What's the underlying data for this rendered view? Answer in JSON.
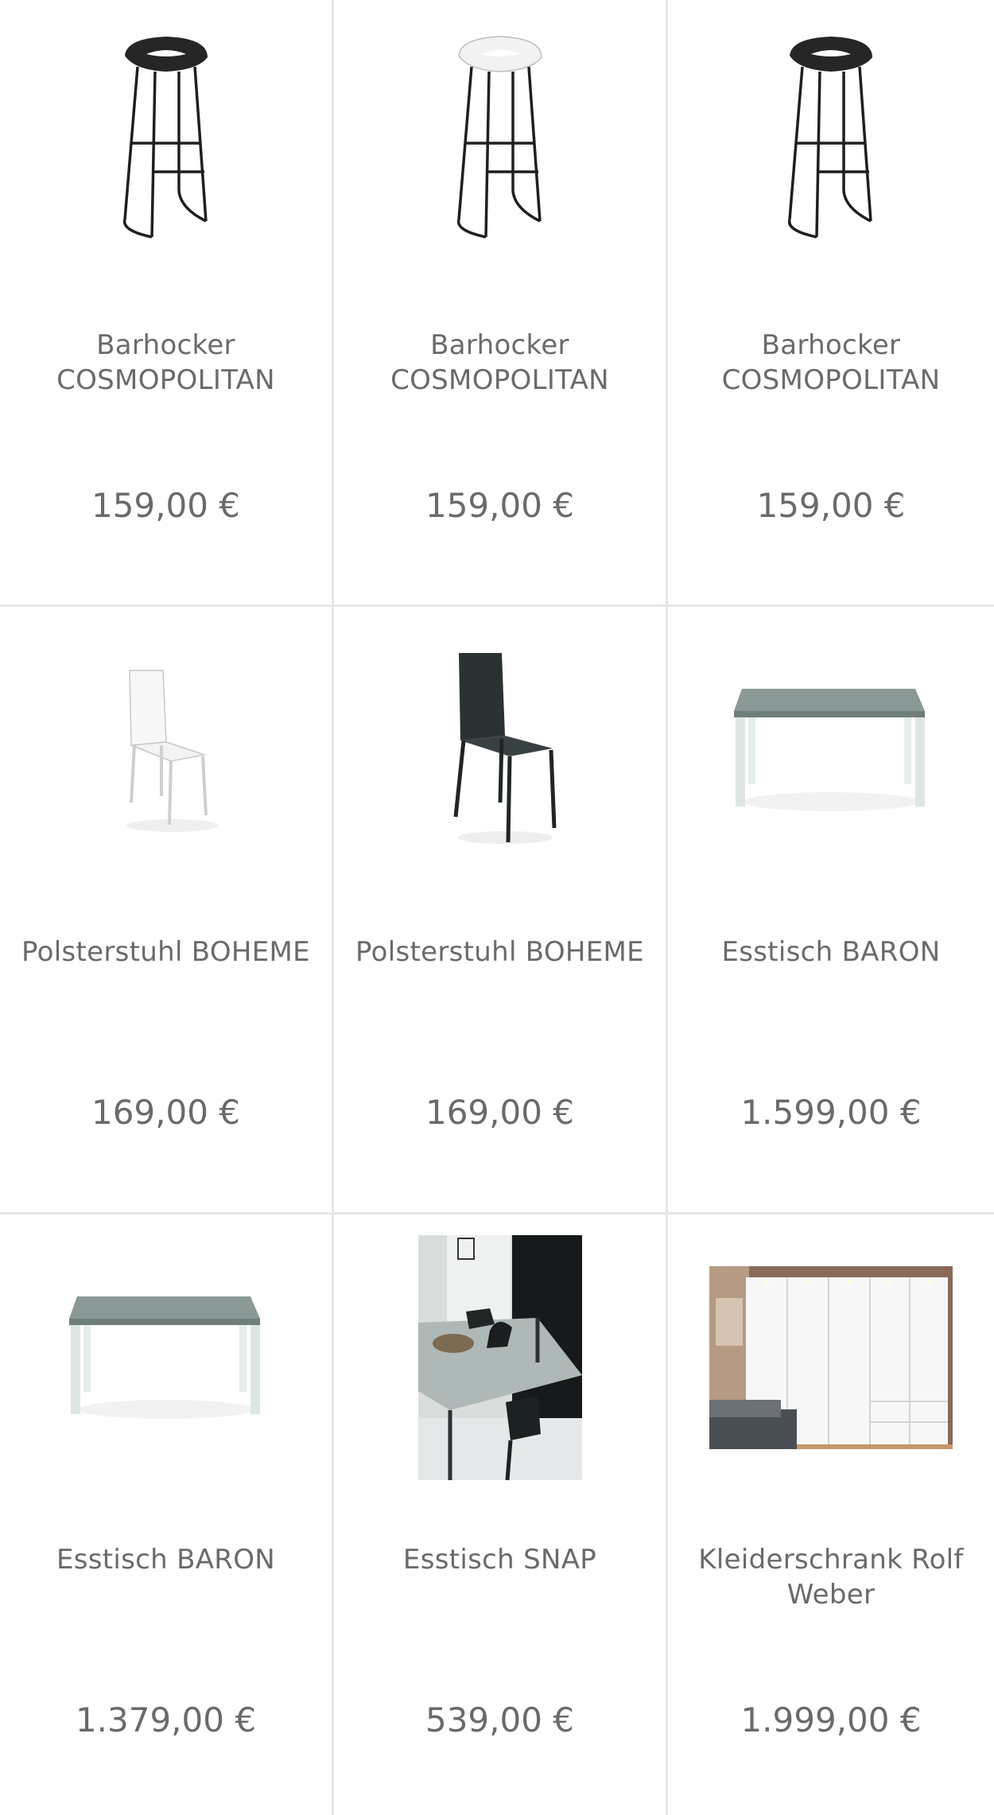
{
  "products": [
    {
      "name": "Barhocker COSMOPOLITAN",
      "price": "159,00 €",
      "image": "bar-stool-black-icon"
    },
    {
      "name": "Barhocker COSMOPOLITAN",
      "price": "159,00 €",
      "image": "bar-stool-white-icon"
    },
    {
      "name": "Barhocker COSMOPOLITAN",
      "price": "159,00 €",
      "image": "bar-stool-black-icon"
    },
    {
      "name": "Polsterstuhl BOHEME",
      "price": "169,00 €",
      "image": "chair-white-icon"
    },
    {
      "name": "Polsterstuhl BOHEME",
      "price": "169,00 €",
      "image": "chair-black-icon"
    },
    {
      "name": "Esstisch BARON",
      "price": "1.599,00 €",
      "image": "dining-table-icon"
    },
    {
      "name": "Esstisch BARON",
      "price": "1.379,00 €",
      "image": "dining-table-icon"
    },
    {
      "name": "Esstisch SNAP",
      "price": "539,00 €",
      "image": "dining-room-photo-icon"
    },
    {
      "name": "Kleiderschrank Rolf Weber",
      "price": "1.999,00 €",
      "image": "wardrobe-photo-icon"
    }
  ],
  "colors": {
    "text": "#6a6a6a",
    "divider": "#e6e6e6",
    "background": "#ffffff"
  }
}
